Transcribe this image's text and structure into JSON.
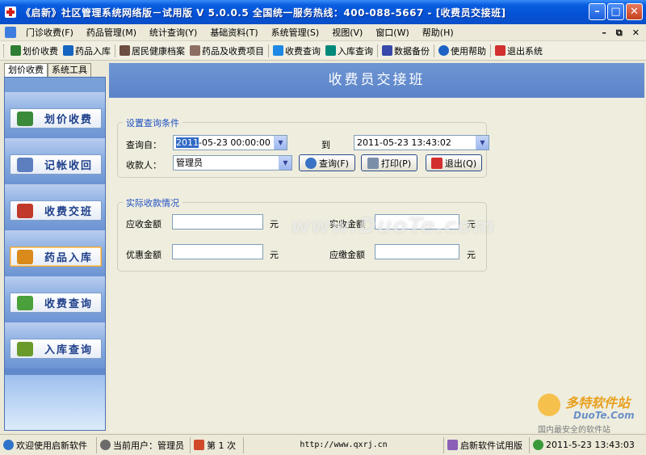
{
  "window": {
    "title": "《启新》社区管理系统网络版－试用版 V 5.0.0.5  全国统一服务热线：400-088-5667 - [收费员交接班]"
  },
  "menu": {
    "items": [
      "门诊收费(F)",
      "药品管理(M)",
      "统计查询(Y)",
      "基础资料(T)",
      "系统管理(S)",
      "视图(V)",
      "窗口(W)",
      "帮助(H)"
    ]
  },
  "toolbar": {
    "items": [
      {
        "label": "划价收费",
        "icon": "pen-icon",
        "color": "#2e7d32"
      },
      {
        "label": "药品入库",
        "icon": "pill-icon",
        "color": "#1565c0"
      },
      {
        "label": "居民健康档案",
        "icon": "magnifier-icon",
        "color": "#6d4c41"
      },
      {
        "label": "药品及收费项目",
        "icon": "table-icon",
        "color": "#8d6e63"
      },
      {
        "label": "收费查询",
        "icon": "search-icon",
        "color": "#1e88e5"
      },
      {
        "label": "入库查询",
        "icon": "people-icon",
        "color": "#00897b"
      },
      {
        "label": "数据备份",
        "icon": "database-icon",
        "color": "#3949ab"
      },
      {
        "label": "使用帮助",
        "icon": "help-icon",
        "color": "#1e63c3"
      },
      {
        "label": "退出系统",
        "icon": "exit-icon",
        "color": "#d32f2f"
      }
    ]
  },
  "left": {
    "tabs": [
      "划价收费",
      "系统工具"
    ],
    "nav": [
      {
        "label": "划价收费",
        "icon": "cash-register-icon",
        "color": "#3a8a3a"
      },
      {
        "label": "记帐收回",
        "icon": "note-icon",
        "color": "#5d7fbf"
      },
      {
        "label": "收费交班",
        "icon": "handover-icon",
        "color": "#c0392b"
      },
      {
        "label": "药品入库",
        "icon": "chart-icon",
        "color": "#d98a1a"
      },
      {
        "label": "收费查询",
        "icon": "search-doc-icon",
        "color": "#4aa03a"
      },
      {
        "label": "入库查询",
        "icon": "box-icon",
        "color": "#6a9a2a"
      }
    ]
  },
  "main": {
    "header": "收费员交接班",
    "query_group": {
      "title": "设置查询条件",
      "from_label": "查询自：",
      "from_value_selected": "2011",
      "from_value_rest": "-05-23 00:00:00",
      "to_label": "到",
      "to_value": "2011-05-23 13:43:02",
      "cashier_label": "收款人：",
      "cashier_value": "管理员",
      "btn_query": "查询(F)",
      "btn_print": "打印(P)",
      "btn_exit": "退出(Q)"
    },
    "actual_group": {
      "title": "实际收款情况",
      "receivable_label": "应收金额",
      "received_label": "实收金额",
      "discount_label": "优惠金额",
      "payable_label": "应缴金额",
      "unit": "元"
    }
  },
  "watermark": {
    "text": "www.DuoTe.com"
  },
  "logo": {
    "brand": "多特软件站",
    "url": "DuoTe.Com",
    "slogan": "国内最安全的软件站"
  },
  "status": {
    "welcome": "欢迎使用启新软件",
    "user": "当前用户：管理员",
    "count": "第 1 次",
    "url": "http://www.qxrj.cn",
    "edition": "启新软件试用版",
    "time": "2011-5-23 13:43:03"
  }
}
